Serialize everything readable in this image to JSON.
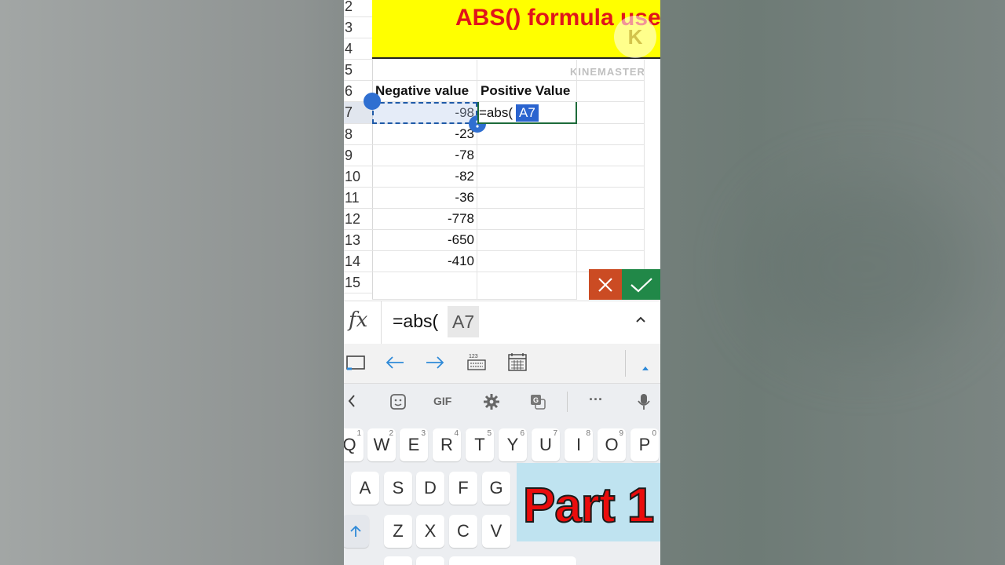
{
  "sheet": {
    "title": "ABS() formula use",
    "watermark": "KINEMASTER",
    "logo_letter": "K",
    "row_numbers": [
      "2",
      "3",
      "4",
      "5",
      "6",
      "7",
      "8",
      "9",
      "10",
      "11",
      "12",
      "13",
      "14",
      "15"
    ],
    "headers": {
      "col_a": "Negative value",
      "col_b": "Positive Value"
    },
    "values": [
      "-98",
      "-23",
      "-78",
      "-82",
      "-36",
      "-778",
      "-650",
      "-410"
    ],
    "editing": {
      "prefix": "=abs(",
      "ref": "A7"
    }
  },
  "formula_bar": {
    "fx_label": "fx",
    "text": "=abs(",
    "ref": "A7"
  },
  "keyboard": {
    "row1": [
      {
        "k": "Q",
        "n": "1"
      },
      {
        "k": "W",
        "n": "2"
      },
      {
        "k": "E",
        "n": "3"
      },
      {
        "k": "R",
        "n": "4"
      },
      {
        "k": "T",
        "n": "5"
      },
      {
        "k": "Y",
        "n": "6"
      },
      {
        "k": "U",
        "n": "7"
      },
      {
        "k": "I",
        "n": "8"
      },
      {
        "k": "O",
        "n": "9"
      },
      {
        "k": "P",
        "n": "0"
      }
    ],
    "row2": [
      "A",
      "S",
      "D",
      "F",
      "G"
    ],
    "row3": [
      "Z",
      "X",
      "C",
      "V"
    ],
    "gif_label": "GIF",
    "more_label": "···"
  },
  "overlay": {
    "text": "Part 1"
  },
  "colors": {
    "title_bg": "#ffff00",
    "title_text": "#e0151b",
    "cancel": "#cb4b23",
    "confirm": "#218848",
    "ref_chip": "#2b64cf",
    "overlay_text": "#ea0c0c"
  }
}
